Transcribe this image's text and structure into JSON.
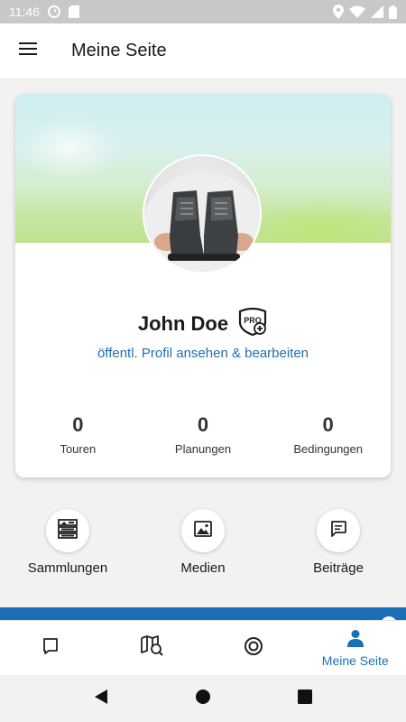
{
  "status_bar": {
    "time": "11:46",
    "icons_left": [
      "sync-icon",
      "sd-card-icon"
    ],
    "icons_right": [
      "location-icon",
      "wifi-icon",
      "signal-icon",
      "battery-icon"
    ]
  },
  "app_bar": {
    "menu_icon": "hamburger-menu-icon",
    "title": "Meine Seite"
  },
  "profile": {
    "name": "John Doe",
    "badge": "PRO",
    "link": "öffentl. Profil ansehen & bearbeiten",
    "stats": [
      {
        "value": "0",
        "label": "Touren"
      },
      {
        "value": "0",
        "label": "Planungen"
      },
      {
        "value": "0",
        "label": "Bedingungen"
      }
    ]
  },
  "quick_actions": [
    {
      "label": "Sammlungen",
      "icon": "collections-icon"
    },
    {
      "label": "Medien",
      "icon": "image-icon"
    },
    {
      "label": "Beiträge",
      "icon": "posts-icon"
    }
  ],
  "bottom_nav": {
    "items": [
      {
        "icon": "bookmark-icon",
        "label": ""
      },
      {
        "icon": "map-search-icon",
        "label": ""
      },
      {
        "icon": "record-icon",
        "label": ""
      },
      {
        "icon": "person-icon",
        "label": "Meine Seite"
      }
    ],
    "active_color": "#1a6fb6"
  },
  "colors": {
    "accent": "#1a6fb6",
    "link": "#1f6fb5",
    "status_bar": "#c8c8c8"
  }
}
